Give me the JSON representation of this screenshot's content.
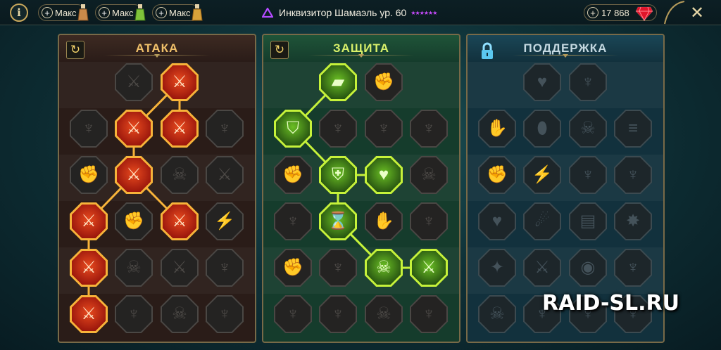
{
  "topbar": {
    "info_label": "i",
    "resources": [
      {
        "plus": "+",
        "label": "Макс",
        "potion_color": "#c98a4a"
      },
      {
        "plus": "+",
        "label": "Макс",
        "potion_color": "#7fc23a"
      },
      {
        "plus": "+",
        "label": "Макс",
        "potion_color": "#d8a23a"
      }
    ],
    "hero_name": "Инквизитор Шамаэль ур. 60",
    "stars": "★★★★★★",
    "gems_plus": "+",
    "gems_value": "17 868",
    "close_label": "✕"
  },
  "colors": {
    "gem": "#e0142a",
    "stars": "#c94bff",
    "attack": "#f7b33a",
    "defense": "#c6f23a"
  },
  "panels": {
    "attack": {
      "title": "АТАКА",
      "reset": "↻"
    },
    "defense": {
      "title": "ЗАЩИТА",
      "reset": "↻"
    },
    "support": {
      "title": "ПОДДЕРЖКА"
    }
  },
  "masteries": {
    "attack": [
      [
        "⚔",
        "⚔"
      ],
      [
        "♆",
        "⚔",
        "⚔",
        "♆"
      ],
      [
        "✊",
        "⚔",
        "☠",
        "⚔"
      ],
      [
        "⚔",
        "✊",
        "⚔",
        "⚡"
      ],
      [
        "⚔",
        "☠",
        "⚔",
        "♆"
      ],
      [
        "⚔",
        "♆",
        "☠",
        "♆"
      ]
    ],
    "defense": [
      [
        "▰",
        "✊"
      ],
      [
        "⛉",
        "♆",
        "♆",
        "♆"
      ],
      [
        "✊",
        "⛨",
        "♥",
        "☠"
      ],
      [
        "♆",
        "⌛",
        "✋",
        "♆"
      ],
      [
        "✊",
        "♆",
        "☠",
        "⚔"
      ],
      [
        "♆",
        "♆",
        "☠",
        "♆"
      ]
    ],
    "support": [
      [
        "♥",
        "♆"
      ],
      [
        "✋",
        "⬮",
        "☠",
        "≡"
      ],
      [
        "✊",
        "⚡",
        "♆",
        "♆"
      ],
      [
        "♥",
        "☄",
        "▤",
        "✸"
      ],
      [
        "✦",
        "⚔",
        "◉",
        "♆"
      ],
      [
        "☠",
        "♆",
        "♆",
        "♆"
      ]
    ]
  },
  "watermark": "RAID-SL.RU"
}
